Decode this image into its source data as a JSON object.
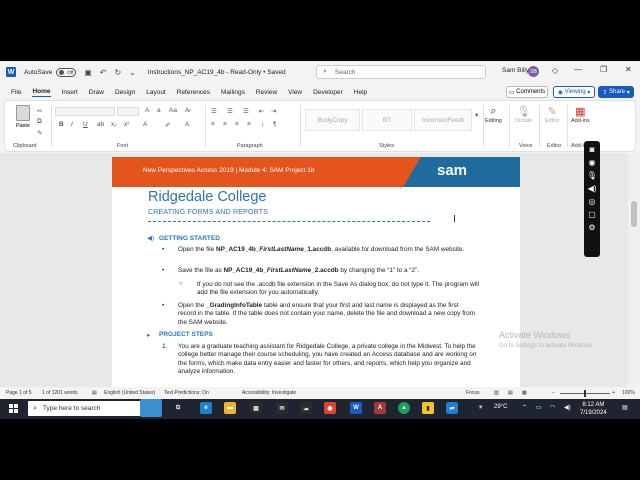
{
  "titlebar": {
    "autosave_label": "AutoSave",
    "autosave_state": "Off",
    "doc_title": "Instructions_NP_AC19_4b  -  Read-Only  •  Saved",
    "search_placeholder": "Search",
    "user_name": "Sam Billy",
    "user_initials": "SB"
  },
  "menu": {
    "tabs": [
      "File",
      "Home",
      "Insert",
      "Draw",
      "Design",
      "Layout",
      "References",
      "Mailings",
      "Review",
      "View",
      "Developer",
      "Help"
    ],
    "active": "Home",
    "comments": "Comments",
    "viewing": "Viewing",
    "share": "Share"
  },
  "ribbon": {
    "paste": "Paste",
    "clipboard": "Clipboard",
    "font": "Font",
    "paragraph": "Paragraph",
    "styles": [
      "BodyCopy",
      "BT",
      "IncorrectFeedt"
    ],
    "styles_label": "Styles",
    "editing": "Editing",
    "dictate": "Dictate",
    "voice": "Voice",
    "editor": "Editor",
    "editor_group": "Editor",
    "addins": "Add-ins",
    "addins_group": "Add-ins"
  },
  "document": {
    "banner": "New Perspectives Access 2019 | Module 4: SAM Project 1b",
    "logo": "sam",
    "title": "Ridgedale College",
    "subtitle": "CREATING FORMS AND REPORTS",
    "section1": "GETTING STARTED",
    "bullet1_a": "Open the file ",
    "bullet1_b": "NP_AC19_4b_",
    "bullet1_c": "FirstLastName",
    "bullet1_d": "_1.accdb",
    "bullet1_e": ", available for download from the SAM website.",
    "bullet2_a": "Save the file as ",
    "bullet2_b": "NP_AC19_4b_",
    "bullet2_c": "FirstLastName",
    "bullet2_d": "_2.accdb",
    "bullet2_e": " by changing the “1” to a “2”.",
    "sub1": "If you do not see the .accdb file extension in the Save As dialog box, do not type it. The program will add the file extension for you automatically.",
    "bullet3_a": "Open the ",
    "bullet3_b": "_GradingInfoTable",
    "bullet3_c": " table and ensure that your first and last name is displayed as the first record in the table. If the table does not contain your name, delete the file and download a new copy from the SAM website.",
    "section2": "PROJECT STEPS",
    "step1_num": "1.",
    "step1": "You are a graduate teaching assistant for Ridgedale College, a private college in the Midwest. To help the college better manage their course scheduling, you have created an Access database and are working on the forms, which make data entry easier and faster for others, and reports, which help you organize and analyze information."
  },
  "watermark": {
    "line1": "Activate Windows",
    "line2": "Go to Settings to activate Windows."
  },
  "statusbar": {
    "page": "Page 1 of 5",
    "words": "1 of 1201 words",
    "language": "English (United States)",
    "predictions": "Text Predictions: On",
    "accessibility": "Accessibility: Investigate",
    "focus": "Focus",
    "zoom": "100%"
  },
  "taskbar": {
    "search_placeholder": "Type here to search",
    "temperature": "29°C",
    "time": "8:12 AM",
    "date": "7/19/2024"
  }
}
